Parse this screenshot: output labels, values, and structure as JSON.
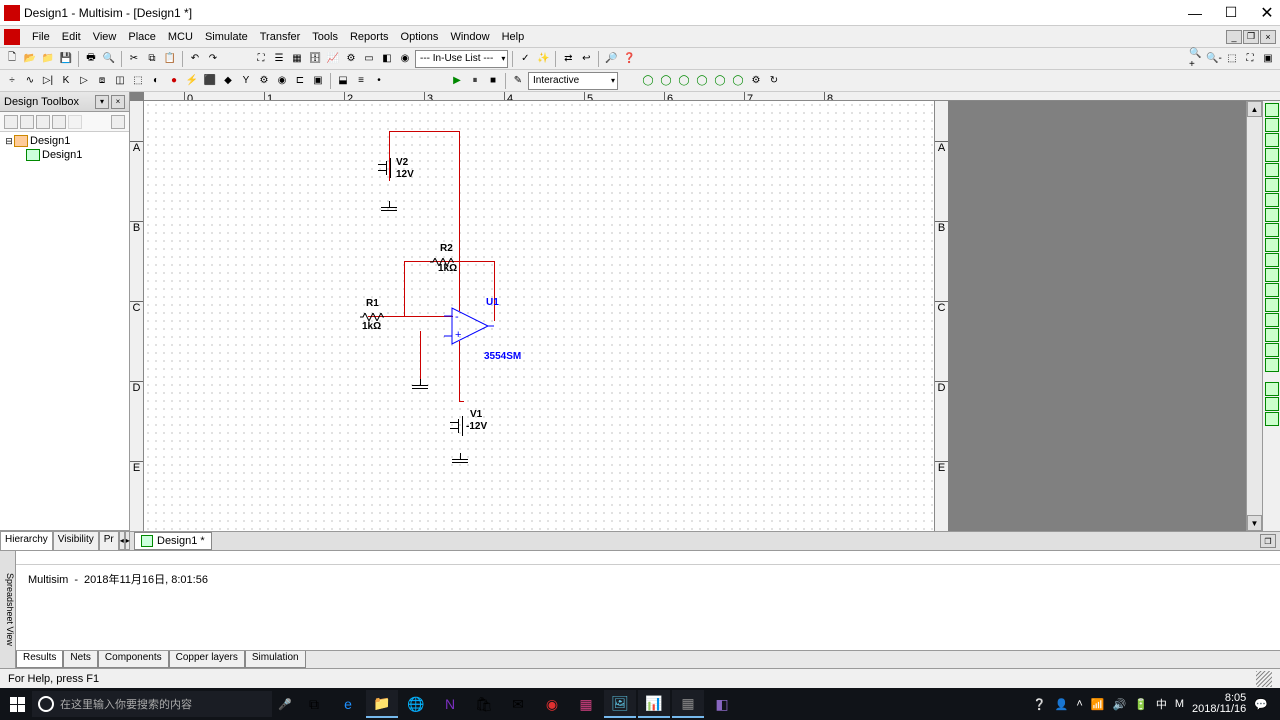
{
  "window": {
    "title": "Design1 - Multisim - [Design1 *]"
  },
  "menu": {
    "items": [
      "File",
      "Edit",
      "View",
      "Place",
      "MCU",
      "Simulate",
      "Transfer",
      "Tools",
      "Reports",
      "Options",
      "Window",
      "Help"
    ]
  },
  "toolbar1": {
    "combo": "--- In-Use List ---"
  },
  "sim_toolbar": {
    "mode": "Interactive"
  },
  "toolbox": {
    "title": "Design Toolbox",
    "tree": {
      "root": "Design1",
      "child": "Design1"
    },
    "tabs": {
      "hierarchy": "Hierarchy",
      "visibility": "Visibility",
      "pr": "Pr"
    }
  },
  "doc_tab": "Design1 *",
  "circuit": {
    "v2": {
      "name": "V2",
      "value": "12V"
    },
    "r2": {
      "name": "R2",
      "value": "1kΩ"
    },
    "r1": {
      "name": "R1",
      "value": "1kΩ"
    },
    "u1": {
      "name": "U1",
      "model": "3554SM"
    },
    "v1": {
      "name": "V1",
      "value": "-12V"
    }
  },
  "spreadsheet": {
    "title": "Spreadsheet View",
    "line": {
      "app": "Multisim",
      "ts": "2018年11月16日, 8:01:56"
    },
    "tabs": [
      "Results",
      "Nets",
      "Components",
      "Copper layers",
      "Simulation"
    ]
  },
  "status": {
    "msg": "For Help, press F1"
  },
  "taskbar": {
    "search_placeholder": "在这里输入你要搜索的内容",
    "clock": {
      "time": "8:05",
      "date": "2018/11/16"
    }
  }
}
